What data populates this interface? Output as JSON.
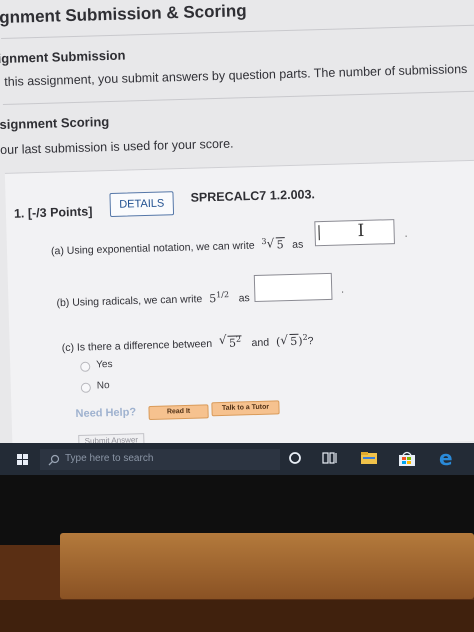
{
  "page": {
    "title": "ignment Submission & Scoring",
    "submission_heading": "ignment Submission",
    "submission_text": "this assignment, you submit answers by question parts. The number of submissions",
    "scoring_heading": "signment Scoring",
    "scoring_text": "our last submission is used for your score."
  },
  "question": {
    "number_label": "1. [-/3 Points]",
    "details_label": "DETAILS",
    "code": "SPRECALC7 1.2.003.",
    "part_a_prefix": "(a) Using exponential notation, we can write",
    "part_a_radical_index": "3",
    "part_a_radicand": "5",
    "part_a_as": "as",
    "part_a_value": "",
    "part_b_prefix": "(b) Using radicals, we can write",
    "part_b_base": "5",
    "part_b_exp": "1/2",
    "part_b_as": "as",
    "part_b_value": "",
    "part_c_prefix": "(c) Is there a difference between",
    "part_c_expr1_radicand": "5",
    "part_c_expr1_exp": "2",
    "part_c_and": "and",
    "part_c_expr2_radicand": "5",
    "part_c_expr2_exp": "2",
    "part_c_end": "?",
    "options": [
      "Yes",
      "No"
    ],
    "need_help_label": "Need Help?",
    "read_it_label": "Read It",
    "tutor_label": "Talk to a Tutor",
    "submit_label": "Submit Answer"
  },
  "taskbar": {
    "search_placeholder": "Type here to search",
    "icons": [
      "windows-start-icon",
      "search-icon",
      "cortana-icon",
      "task-view-icon",
      "file-explorer-icon",
      "store-icon",
      "edge-icon"
    ]
  },
  "colors": {
    "details_border": "#5577a8",
    "help_buttons": "#f6c28f",
    "taskbar": "#232b36",
    "edge_blue": "#2a8ad8"
  }
}
